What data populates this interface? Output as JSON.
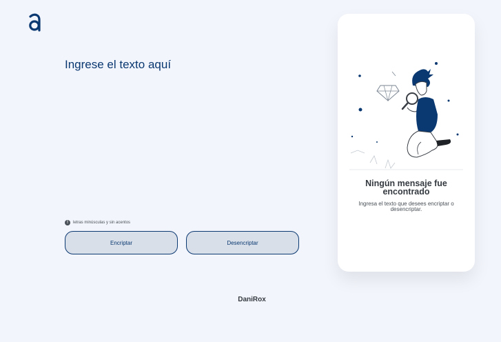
{
  "input": {
    "placeholder": "Ingrese el texto aquí",
    "value": ""
  },
  "hint": {
    "text": "letras minúsculas y sin acentos"
  },
  "buttons": {
    "encrypt": "Encriptar",
    "decrypt": "Desencriptar"
  },
  "result": {
    "title": "Ningún mensaje fue encontrado",
    "subtitle": "Ingresa el texto que desees encriptar o desencriptar."
  },
  "footer": {
    "text": "DaniRox"
  },
  "colors": {
    "accent": "#0a3871",
    "background": "#f3f5fc",
    "button_bg": "#d8dfe8"
  },
  "icons": {
    "logo": "alura-logo-icon",
    "hint": "info-icon",
    "illustration": "magnifier-person-illustration"
  }
}
